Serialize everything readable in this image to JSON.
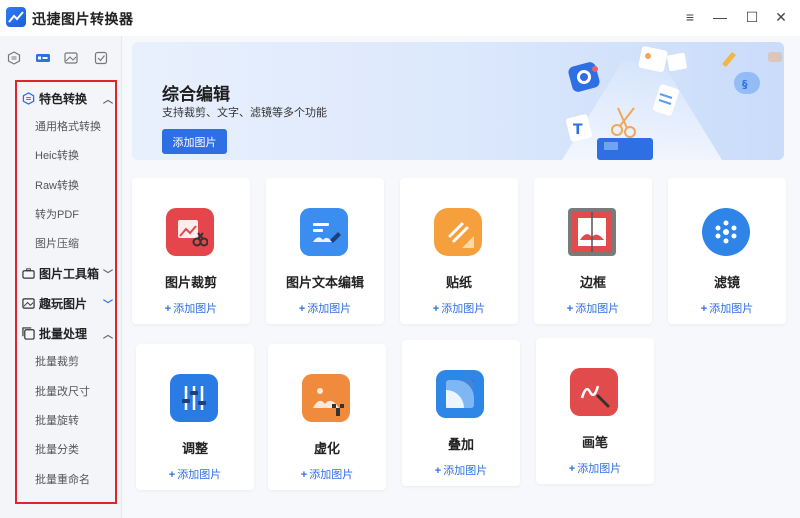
{
  "app": {
    "title": "迅捷图片转换器"
  },
  "window_controls": {
    "menu": "≡",
    "minimize": "—",
    "maximize": "☐",
    "close": "✕"
  },
  "sidebar": {
    "groups": [
      {
        "label": "特色转换",
        "expanded": true,
        "items": [
          "通用格式转换",
          "Heic转换",
          "Raw转换",
          "转为PDF",
          "图片压缩"
        ]
      },
      {
        "label": "图片工具箱",
        "expanded": false,
        "items": []
      },
      {
        "label": "趣玩图片",
        "expanded": false,
        "items": []
      },
      {
        "label": "批量处理",
        "expanded": true,
        "items": [
          "批量裁剪",
          "批量改尺寸",
          "批量旋转",
          "批量分类",
          "批量重命名"
        ]
      }
    ]
  },
  "banner": {
    "title": "综合编辑",
    "subtitle": "支持裁剪、文字、滤镜等多个功能",
    "button": "添加图片"
  },
  "tools": [
    {
      "title": "图片裁剪",
      "add": "添加图片",
      "color": "#e4464c"
    },
    {
      "title": "图片文本编辑",
      "add": "添加图片",
      "color": "#3b8ef0"
    },
    {
      "title": "贴纸",
      "add": "添加图片",
      "color": "#f5a03c"
    },
    {
      "title": "边框",
      "add": "添加图片",
      "color": "#e14b4b"
    },
    {
      "title": "滤镜",
      "add": "添加图片",
      "color": "#2f84e8"
    },
    {
      "title": "调整",
      "add": "添加图片",
      "color": "#2b7be4"
    },
    {
      "title": "虚化",
      "add": "添加图片",
      "color": "#f08a3c"
    },
    {
      "title": "叠加",
      "add": "添加图片",
      "color": "#2e86e6"
    },
    {
      "title": "画笔",
      "add": "添加图片",
      "color": "#e14b4b"
    }
  ]
}
